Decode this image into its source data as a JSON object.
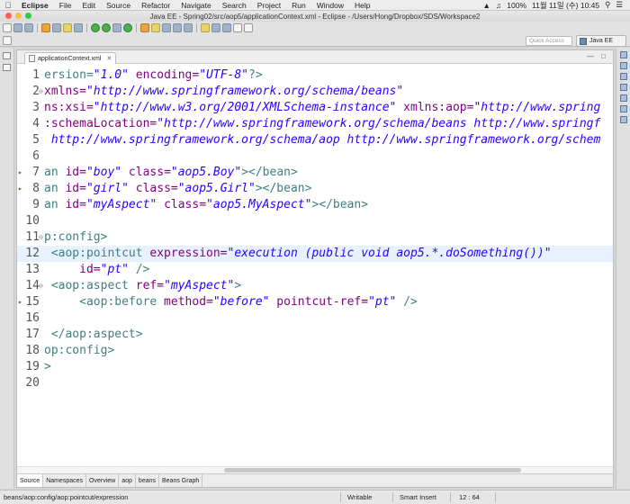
{
  "menubar": {
    "app": "Eclipse",
    "items": [
      "File",
      "Edit",
      "Source",
      "Refactor",
      "Navigate",
      "Search",
      "Project",
      "Run",
      "Window",
      "Help"
    ],
    "battery": "100%",
    "clock": "11월 11일 (수)  10:45"
  },
  "window": {
    "title": "Java EE - Spring02/src/aop5/applicationContext.xml - Eclipse - /Users/Hong/Dropbox/SDS/Workspace2"
  },
  "toolbar": {
    "quick_access_placeholder": "Quick Access",
    "perspective_label": "Java EE"
  },
  "editor": {
    "tab_label": "applicationContext.xml",
    "tab_close": "✕"
  },
  "code_lines": [
    {
      "num": "1",
      "parts": [
        {
          "c": "t",
          "v": "ersion="
        },
        {
          "c": "s",
          "v": "\"1.0\""
        },
        {
          "c": "a",
          "v": " encoding="
        },
        {
          "c": "s",
          "v": "\"UTF-8\""
        },
        {
          "c": "t",
          "v": "?>"
        }
      ]
    },
    {
      "num": "2",
      "parts": [
        {
          "c": "a",
          "v": "xmlns="
        },
        {
          "c": "s",
          "v": "\"http://www.springframework.org/schema/beans\""
        }
      ]
    },
    {
      "num": "3",
      "parts": [
        {
          "c": "a",
          "v": "ns:xsi="
        },
        {
          "c": "s",
          "v": "\"http://www.w3.org/2001/XMLSchema-instance\""
        },
        {
          "c": "a",
          "v": " xmlns:aop="
        },
        {
          "c": "s",
          "v": "\"http://www.spring"
        }
      ]
    },
    {
      "num": "4",
      "parts": [
        {
          "c": "a",
          "v": ":schemaLocation="
        },
        {
          "c": "s",
          "v": "\"http://www.springframework.org/schema/beans http://www.springf"
        }
      ]
    },
    {
      "num": "5",
      "parts": [
        {
          "c": "s",
          "v": " http://www.springframework.org/schema/aop http://www.springframework.org/schem"
        }
      ]
    },
    {
      "num": "6",
      "parts": []
    },
    {
      "num": "7",
      "parts": [
        {
          "c": "t",
          "v": "an "
        },
        {
          "c": "a",
          "v": "id="
        },
        {
          "c": "s",
          "v": "\"boy\""
        },
        {
          "c": "a",
          "v": " class="
        },
        {
          "c": "s",
          "v": "\"aop5.Boy\""
        },
        {
          "c": "t",
          "v": "></bean>"
        }
      ]
    },
    {
      "num": "8",
      "parts": [
        {
          "c": "t",
          "v": "an "
        },
        {
          "c": "a",
          "v": "id="
        },
        {
          "c": "s",
          "v": "\"girl\""
        },
        {
          "c": "a",
          "v": " class="
        },
        {
          "c": "s",
          "v": "\"aop5.Girl\""
        },
        {
          "c": "t",
          "v": "></bean>"
        }
      ]
    },
    {
      "num": "9",
      "parts": [
        {
          "c": "t",
          "v": "an "
        },
        {
          "c": "a",
          "v": "id="
        },
        {
          "c": "s",
          "v": "\"myAspect\""
        },
        {
          "c": "a",
          "v": " class="
        },
        {
          "c": "s",
          "v": "\"aop5.MyAspect\""
        },
        {
          "c": "t",
          "v": "></bean>"
        }
      ]
    },
    {
      "num": "10",
      "parts": []
    },
    {
      "num": "11",
      "parts": [
        {
          "c": "t",
          "v": "p:config>"
        }
      ]
    },
    {
      "num": "12",
      "parts": [
        {
          "c": "t",
          "v": " <aop:pointcut"
        },
        {
          "c": "a",
          "v": " expression="
        },
        {
          "c": "s",
          "v": "\"execution (public void aop5.*.doSomething())\""
        }
      ]
    },
    {
      "num": "13",
      "parts": [
        {
          "c": "a",
          "v": "     id="
        },
        {
          "c": "s",
          "v": "\"pt\""
        },
        {
          "c": "t",
          "v": " />"
        }
      ]
    },
    {
      "num": "14",
      "parts": [
        {
          "c": "t",
          "v": " <aop:aspect"
        },
        {
          "c": "a",
          "v": " ref="
        },
        {
          "c": "s",
          "v": "\"myAspect\""
        },
        {
          "c": "t",
          "v": ">"
        }
      ]
    },
    {
      "num": "15",
      "parts": [
        {
          "c": "t",
          "v": "     <aop:before"
        },
        {
          "c": "a",
          "v": " method="
        },
        {
          "c": "s",
          "v": "\"before\""
        },
        {
          "c": "a",
          "v": " pointcut-ref="
        },
        {
          "c": "s",
          "v": "\"pt\""
        },
        {
          "c": "t",
          "v": " />"
        }
      ]
    },
    {
      "num": "16",
      "parts": []
    },
    {
      "num": "17",
      "parts": [
        {
          "c": "t",
          "v": " </aop:aspect>"
        }
      ]
    },
    {
      "num": "18",
      "parts": [
        {
          "c": "t",
          "v": "op:config>"
        }
      ]
    },
    {
      "num": "19",
      "parts": [
        {
          "c": "t",
          "v": ">"
        }
      ]
    },
    {
      "num": "20",
      "parts": []
    }
  ],
  "bottom_tabs": [
    "Source",
    "Namespaces",
    "Overview",
    "aop",
    "beans",
    "Beans Graph"
  ],
  "status": {
    "path": "beans/aop:config/aop:pointcut/expression",
    "mode": "Writable",
    "insert": "Smart Insert",
    "position": "12 : 64"
  }
}
